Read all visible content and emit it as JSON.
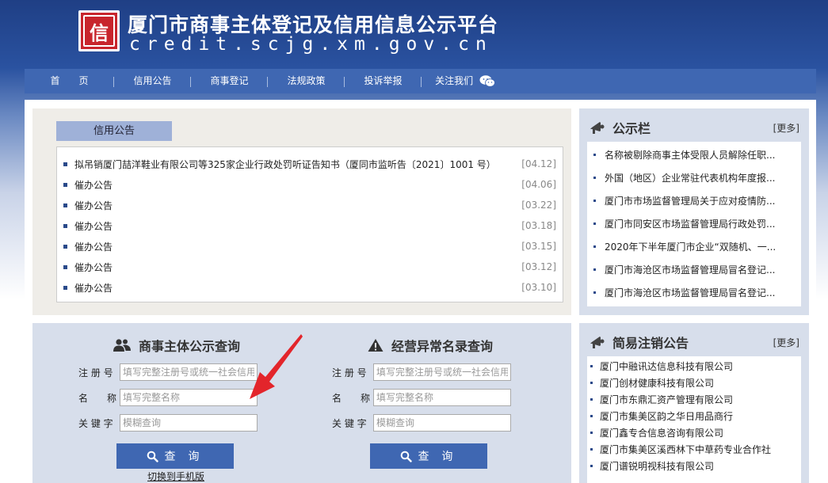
{
  "header": {
    "logo_char": "信",
    "title": "厦门市商事主体登记及信用信息公示平台",
    "domain": "credit.scjg.xm.gov.cn"
  },
  "nav": {
    "items": [
      {
        "label": "首　　页"
      },
      {
        "label": "信用公告"
      },
      {
        "label": "商事登记"
      },
      {
        "label": "法规政策"
      },
      {
        "label": "投诉举报"
      },
      {
        "label": "关注我们"
      }
    ]
  },
  "announcements": {
    "tab_label": "信用公告",
    "items": [
      {
        "title": "拟吊销厦门喆洋鞋业有限公司等325家企业行政处罚听证告知书（厦同市监听告〔2021〕1001 号）",
        "date": "[04.12]"
      },
      {
        "title": "催办公告",
        "date": "[04.06]"
      },
      {
        "title": "催办公告",
        "date": "[03.22]"
      },
      {
        "title": "催办公告",
        "date": "[03.18]"
      },
      {
        "title": "催办公告",
        "date": "[03.15]"
      },
      {
        "title": "催办公告",
        "date": "[03.12]"
      },
      {
        "title": "催办公告",
        "date": "[03.10]"
      }
    ]
  },
  "notice_board": {
    "title": "公示栏",
    "more_label": "[更多]",
    "items": [
      {
        "text": "名称被剔除商事主体受限人员解除任职..."
      },
      {
        "text": "外国（地区）企业常驻代表机构年度报..."
      },
      {
        "text": "厦门市市场监督管理局关于应对疫情防..."
      },
      {
        "text": "厦门市同安区市场监督管理局行政处罚..."
      },
      {
        "text": "2020年下半年厦门市企业“双随机、一..."
      },
      {
        "text": "厦门市海沧区市场监督管理局冒名登记..."
      },
      {
        "text": "厦门市海沧区市场监督管理局冒名登记..."
      }
    ]
  },
  "dereg": {
    "title": "简易注销公告",
    "more_label": "[更多]",
    "items": [
      {
        "text": "厦门中融讯达信息科技有限公司"
      },
      {
        "text": "厦门创材健康科技有限公司"
      },
      {
        "text": "厦门市东鼎汇资产管理有限公司"
      },
      {
        "text": "厦门市集美区韵之华日用品商行"
      },
      {
        "text": "厦门鑫专合信息咨询有限公司"
      },
      {
        "text": "厦门市集美区溪西林下中草药专业合作社"
      },
      {
        "text": "厦门谱锐明视科技有限公司"
      }
    ]
  },
  "search_entity": {
    "heading": "商事主体公示查询",
    "reg_label": "注 册 号",
    "reg_placeholder": "填写完整注册号或统一社会信用代码",
    "name_label": "名　　称",
    "name_placeholder": "填写完整名称",
    "kw_label": "关 键 字",
    "kw_placeholder": "模糊查询",
    "button_label": "查 询"
  },
  "search_abnormal": {
    "heading": "经营异常名录查询",
    "reg_label": "注 册 号",
    "reg_placeholder": "填写完整注册号或统一社会信用代码",
    "name_label": "名　　称",
    "name_placeholder": "填写完整名称",
    "kw_label": "关 键 字",
    "kw_placeholder": "模糊查询",
    "button_label": "查 询"
  },
  "mobile_link": "切换到手机版",
  "colors": {
    "nav_blue": "#3f67b2",
    "logo_red": "#c8252c",
    "arrow_red": "#e3252b"
  }
}
